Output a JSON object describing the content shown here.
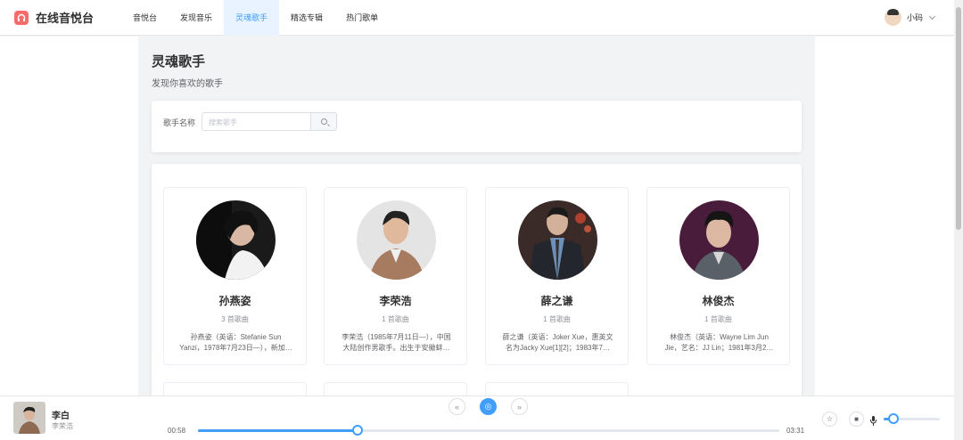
{
  "app": {
    "title": "在线音悦台",
    "brand_color": "#f56c6c",
    "accent": "#409eff"
  },
  "nav": {
    "items": [
      {
        "label": "音悦台",
        "active": false
      },
      {
        "label": "发现音乐",
        "active": false
      },
      {
        "label": "灵魂歌手",
        "active": true
      },
      {
        "label": "精选专辑",
        "active": false
      },
      {
        "label": "热门歌单",
        "active": false
      }
    ]
  },
  "user": {
    "name": "小码",
    "icon": "chevron-down-icon"
  },
  "page": {
    "title": "灵魂歌手",
    "subtitle": "发现你喜欢的歌手"
  },
  "search": {
    "label": "歌手名称",
    "placeholder": "搜索歌手",
    "icon": "search-icon"
  },
  "artists": [
    {
      "name": "孙燕姿",
      "count": "3 首歌曲",
      "desc": "孙燕姿（英语：Stefanie Sun Yanzi，1978年7月23日—），新加…"
    },
    {
      "name": "李荣浩",
      "count": "1 首歌曲",
      "desc": "李荣浩（1985年7月11日—），中国大陆创作男歌手。出生于安徽蚌…"
    },
    {
      "name": "薛之谦",
      "count": "1 首歌曲",
      "desc": "薛之谦（英语：Joker Xue，惠英文名为Jacky Xue[1][2]；1983年7…"
    },
    {
      "name": "林俊杰",
      "count": "1 首歌曲",
      "desc": "林俊杰（英语：Wayne Lim Jun Jie，艺名：JJ Lin；1981年3月2…"
    }
  ],
  "player": {
    "song": "李白",
    "artist": "李荣浩",
    "current_time": "00:58",
    "total_time": "03:31",
    "progress": 0.275,
    "volume": 0.18,
    "controls": {
      "prev": "«",
      "play": "◎",
      "next": "»"
    },
    "icons": [
      "star-icon",
      "stop-icon",
      "mic-icon"
    ]
  }
}
